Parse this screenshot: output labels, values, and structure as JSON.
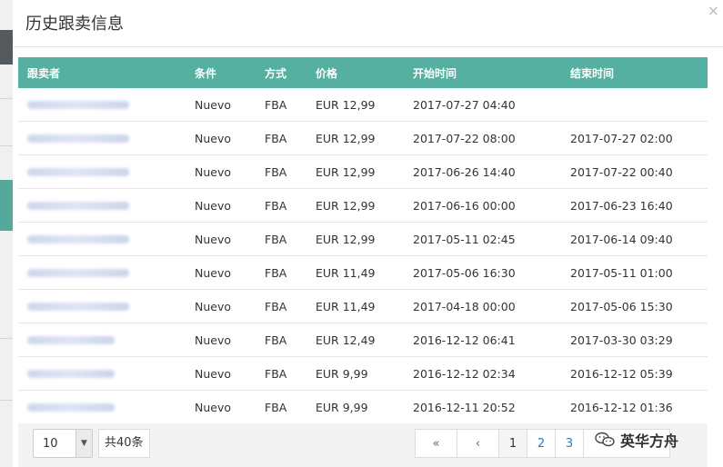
{
  "modal": {
    "title": "历史跟卖信息",
    "close_symbol": "×"
  },
  "table": {
    "headers": [
      "跟卖者",
      "条件",
      "方式",
      "价格",
      "开始时间",
      "结束时间"
    ],
    "rows": [
      {
        "condition": "Nuevo",
        "mode": "FBA",
        "price": "EUR 12,99",
        "start": "2017-07-27 04:40",
        "end": ""
      },
      {
        "condition": "Nuevo",
        "mode": "FBA",
        "price": "EUR 12,99",
        "start": "2017-07-22 08:00",
        "end": "2017-07-27 02:00"
      },
      {
        "condition": "Nuevo",
        "mode": "FBA",
        "price": "EUR 12,99",
        "start": "2017-06-26 14:40",
        "end": "2017-07-22 00:40"
      },
      {
        "condition": "Nuevo",
        "mode": "FBA",
        "price": "EUR 12,99",
        "start": "2017-06-16 00:00",
        "end": "2017-06-23 16:40"
      },
      {
        "condition": "Nuevo",
        "mode": "FBA",
        "price": "EUR 12,99",
        "start": "2017-05-11 02:45",
        "end": "2017-06-14 09:40"
      },
      {
        "condition": "Nuevo",
        "mode": "FBA",
        "price": "EUR 11,49",
        "start": "2017-05-06 16:30",
        "end": "2017-05-11 01:00"
      },
      {
        "condition": "Nuevo",
        "mode": "FBA",
        "price": "EUR 11,49",
        "start": "2017-04-18 00:00",
        "end": "2017-05-06 15:30"
      },
      {
        "condition": "Nuevo",
        "mode": "FBA",
        "price": "EUR 12,49",
        "start": "2016-12-12 06:41",
        "end": "2017-03-30 03:29"
      },
      {
        "condition": "Nuevo",
        "mode": "FBA",
        "price": "EUR 9,99",
        "start": "2016-12-12 02:34",
        "end": "2016-12-12 05:39"
      },
      {
        "condition": "Nuevo",
        "mode": "FBA",
        "price": "EUR 9,99",
        "start": "2016-12-11 20:52",
        "end": "2016-12-12 01:36"
      }
    ]
  },
  "footer": {
    "page_size": "10",
    "total": "共40条",
    "pager": {
      "first": "«",
      "prev": "‹",
      "pages": [
        "1",
        "2",
        "3"
      ],
      "active_page": "1"
    }
  },
  "watermark": {
    "text": "英华方舟",
    "icon": "wechat-icon"
  },
  "colors": {
    "header_bg": "#55b0a1",
    "link": "#2a7bc0"
  }
}
